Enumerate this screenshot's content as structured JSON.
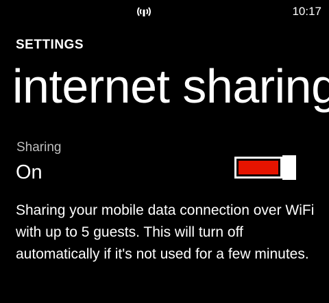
{
  "status_bar": {
    "time": "10:17",
    "signal_icon": "internet-sharing-signal-icon"
  },
  "header": {
    "app_title": "SETTINGS",
    "page_title": "internet sharing"
  },
  "sharing": {
    "label": "Sharing",
    "state": "On",
    "toggle_on": true,
    "toggle_level": 1.0,
    "accent_color": "#e51400"
  },
  "description": "Sharing your mobile data connection over WiFi with up to 5 guests. This will turn off automatically if it's not used for a few minutes."
}
